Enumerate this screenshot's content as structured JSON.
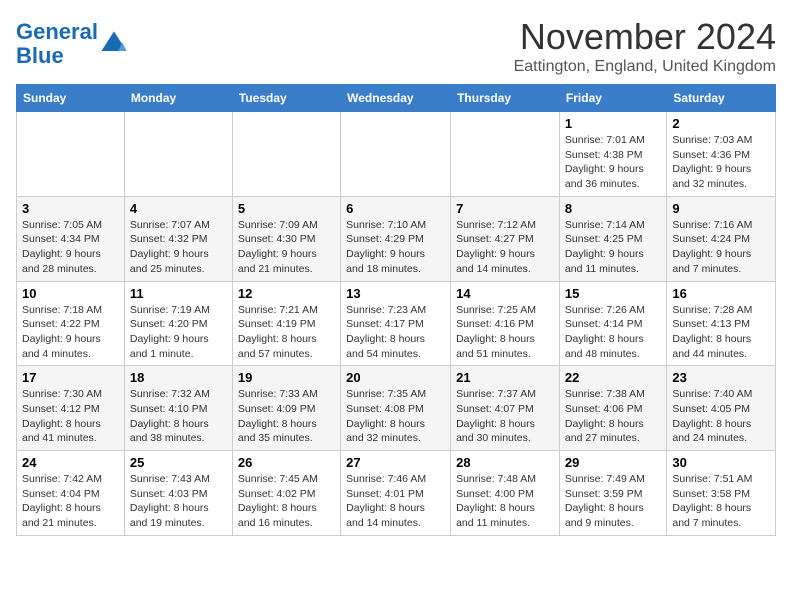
{
  "logo": {
    "text_general": "General",
    "text_blue": "Blue"
  },
  "header": {
    "month": "November 2024",
    "location": "Eattington, England, United Kingdom"
  },
  "weekdays": [
    "Sunday",
    "Monday",
    "Tuesday",
    "Wednesday",
    "Thursday",
    "Friday",
    "Saturday"
  ],
  "weeks": [
    [
      {
        "day": "",
        "info": ""
      },
      {
        "day": "",
        "info": ""
      },
      {
        "day": "",
        "info": ""
      },
      {
        "day": "",
        "info": ""
      },
      {
        "day": "",
        "info": ""
      },
      {
        "day": "1",
        "info": "Sunrise: 7:01 AM\nSunset: 4:38 PM\nDaylight: 9 hours and 36 minutes."
      },
      {
        "day": "2",
        "info": "Sunrise: 7:03 AM\nSunset: 4:36 PM\nDaylight: 9 hours and 32 minutes."
      }
    ],
    [
      {
        "day": "3",
        "info": "Sunrise: 7:05 AM\nSunset: 4:34 PM\nDaylight: 9 hours and 28 minutes."
      },
      {
        "day": "4",
        "info": "Sunrise: 7:07 AM\nSunset: 4:32 PM\nDaylight: 9 hours and 25 minutes."
      },
      {
        "day": "5",
        "info": "Sunrise: 7:09 AM\nSunset: 4:30 PM\nDaylight: 9 hours and 21 minutes."
      },
      {
        "day": "6",
        "info": "Sunrise: 7:10 AM\nSunset: 4:29 PM\nDaylight: 9 hours and 18 minutes."
      },
      {
        "day": "7",
        "info": "Sunrise: 7:12 AM\nSunset: 4:27 PM\nDaylight: 9 hours and 14 minutes."
      },
      {
        "day": "8",
        "info": "Sunrise: 7:14 AM\nSunset: 4:25 PM\nDaylight: 9 hours and 11 minutes."
      },
      {
        "day": "9",
        "info": "Sunrise: 7:16 AM\nSunset: 4:24 PM\nDaylight: 9 hours and 7 minutes."
      }
    ],
    [
      {
        "day": "10",
        "info": "Sunrise: 7:18 AM\nSunset: 4:22 PM\nDaylight: 9 hours and 4 minutes."
      },
      {
        "day": "11",
        "info": "Sunrise: 7:19 AM\nSunset: 4:20 PM\nDaylight: 9 hours and 1 minute."
      },
      {
        "day": "12",
        "info": "Sunrise: 7:21 AM\nSunset: 4:19 PM\nDaylight: 8 hours and 57 minutes."
      },
      {
        "day": "13",
        "info": "Sunrise: 7:23 AM\nSunset: 4:17 PM\nDaylight: 8 hours and 54 minutes."
      },
      {
        "day": "14",
        "info": "Sunrise: 7:25 AM\nSunset: 4:16 PM\nDaylight: 8 hours and 51 minutes."
      },
      {
        "day": "15",
        "info": "Sunrise: 7:26 AM\nSunset: 4:14 PM\nDaylight: 8 hours and 48 minutes."
      },
      {
        "day": "16",
        "info": "Sunrise: 7:28 AM\nSunset: 4:13 PM\nDaylight: 8 hours and 44 minutes."
      }
    ],
    [
      {
        "day": "17",
        "info": "Sunrise: 7:30 AM\nSunset: 4:12 PM\nDaylight: 8 hours and 41 minutes."
      },
      {
        "day": "18",
        "info": "Sunrise: 7:32 AM\nSunset: 4:10 PM\nDaylight: 8 hours and 38 minutes."
      },
      {
        "day": "19",
        "info": "Sunrise: 7:33 AM\nSunset: 4:09 PM\nDaylight: 8 hours and 35 minutes."
      },
      {
        "day": "20",
        "info": "Sunrise: 7:35 AM\nSunset: 4:08 PM\nDaylight: 8 hours and 32 minutes."
      },
      {
        "day": "21",
        "info": "Sunrise: 7:37 AM\nSunset: 4:07 PM\nDaylight: 8 hours and 30 minutes."
      },
      {
        "day": "22",
        "info": "Sunrise: 7:38 AM\nSunset: 4:06 PM\nDaylight: 8 hours and 27 minutes."
      },
      {
        "day": "23",
        "info": "Sunrise: 7:40 AM\nSunset: 4:05 PM\nDaylight: 8 hours and 24 minutes."
      }
    ],
    [
      {
        "day": "24",
        "info": "Sunrise: 7:42 AM\nSunset: 4:04 PM\nDaylight: 8 hours and 21 minutes."
      },
      {
        "day": "25",
        "info": "Sunrise: 7:43 AM\nSunset: 4:03 PM\nDaylight: 8 hours and 19 minutes."
      },
      {
        "day": "26",
        "info": "Sunrise: 7:45 AM\nSunset: 4:02 PM\nDaylight: 8 hours and 16 minutes."
      },
      {
        "day": "27",
        "info": "Sunrise: 7:46 AM\nSunset: 4:01 PM\nDaylight: 8 hours and 14 minutes."
      },
      {
        "day": "28",
        "info": "Sunrise: 7:48 AM\nSunset: 4:00 PM\nDaylight: 8 hours and 11 minutes."
      },
      {
        "day": "29",
        "info": "Sunrise: 7:49 AM\nSunset: 3:59 PM\nDaylight: 8 hours and 9 minutes."
      },
      {
        "day": "30",
        "info": "Sunrise: 7:51 AM\nSunset: 3:58 PM\nDaylight: 8 hours and 7 minutes."
      }
    ]
  ]
}
